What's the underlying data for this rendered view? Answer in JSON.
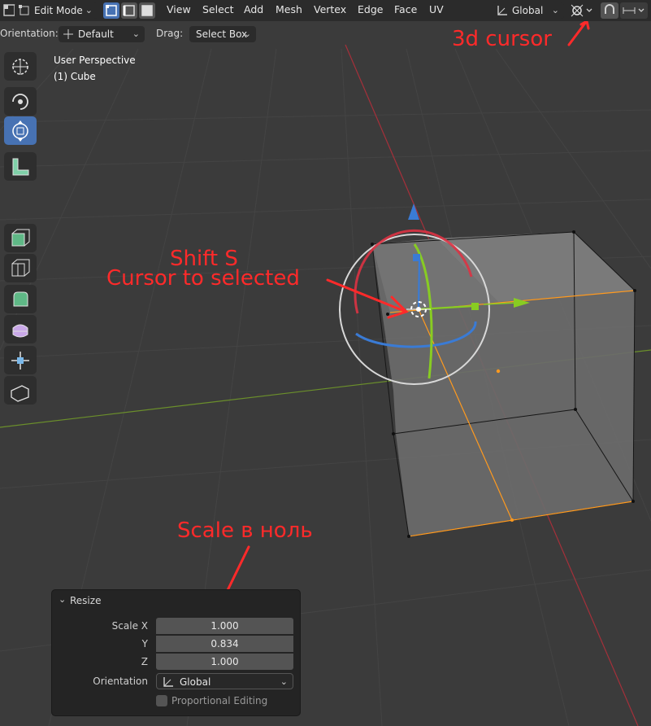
{
  "header": {
    "mode": "Edit Mode",
    "menus": [
      "View",
      "Select",
      "Add",
      "Mesh",
      "Vertex",
      "Edge",
      "Face",
      "UV"
    ],
    "transform_orientation": "Global"
  },
  "subheader": {
    "orientation_label": "Orientation:",
    "orientation_value": "Default",
    "drag_label": "Drag:",
    "drag_value": "Select Box"
  },
  "viewport": {
    "view_name": "User Perspective",
    "object_name": "(1) Cube"
  },
  "annotations": {
    "cursor3d": "3d cursor",
    "shift_s": "Shift S",
    "cursor_to_selected": "Cursor to selected",
    "scale_zero": "Scale в ноль",
    "color": "#ff2a2a"
  },
  "resize_panel": {
    "title": "Resize",
    "scale_x_label": "Scale X",
    "scale_x": "1.000",
    "y_label": "Y",
    "y": "0.834",
    "z_label": "Z",
    "z": "1.000",
    "orientation_label": "Orientation",
    "orientation_value": "Global",
    "proportional_label": "Proportional Editing"
  },
  "colors": {
    "accent": "#4772b3",
    "x_axis": "#dd3344",
    "y_axis": "#88cc22",
    "z_axis": "#3a7bd5",
    "selection": "#ff9a1f"
  }
}
